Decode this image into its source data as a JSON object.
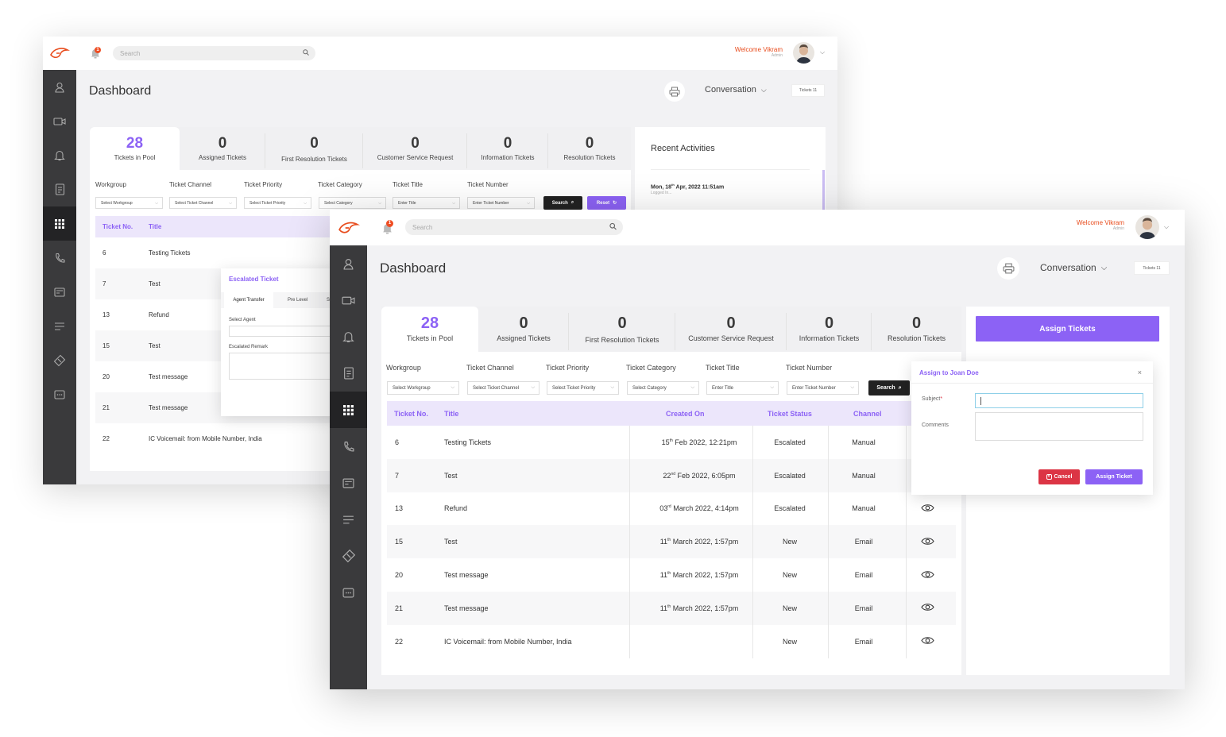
{
  "app": {
    "search_placeholder": "Search",
    "notifications": "1",
    "welcome": "Welcome Vikram",
    "role": "Admin",
    "page_title": "Dashboard",
    "conversation": "Conversation",
    "tickets_badge": "Tickets 11"
  },
  "stats": [
    {
      "value": "28",
      "label": "Tickets in Pool"
    },
    {
      "value": "0",
      "label": "Assigned Tickets"
    },
    {
      "value": "0",
      "label": "First Resolution Tickets"
    },
    {
      "value": "0",
      "label": "Customer Service Request"
    },
    {
      "value": "0",
      "label": "Information Tickets"
    },
    {
      "value": "0",
      "label": "Resolution Tickets"
    }
  ],
  "filters": {
    "labels": [
      "Workgroup",
      "Ticket Channel",
      "Ticket Priority",
      "Ticket Category",
      "Ticket Title",
      "Ticket Number"
    ],
    "placeholders": [
      "Select Workgroup",
      "Select Ticket Channel",
      "Select Ticket Priority",
      "Select Category",
      "Enter Title",
      "Enter Ticket Number"
    ],
    "search": "Search",
    "reset": "Reset"
  },
  "table": {
    "headers": [
      "Ticket No.",
      "Title",
      "Created On",
      "Ticket Status",
      "Channel"
    ],
    "rows": [
      {
        "no": "6",
        "title": "Testing Tickets",
        "created_main": "15",
        "created_sup": "th",
        "created_rest": " Feb 2022, 12:21pm",
        "status": "Escalated",
        "channel": "Manual"
      },
      {
        "no": "7",
        "title": "Test",
        "created_main": "22",
        "created_sup": "nd",
        "created_rest": " Feb 2022, 6:05pm",
        "status": "Escalated",
        "channel": "Manual"
      },
      {
        "no": "13",
        "title": "Refund",
        "created_main": "03",
        "created_sup": "rd",
        "created_rest": " March 2022, 4:14pm",
        "status": "Escalated",
        "channel": "Manual"
      },
      {
        "no": "15",
        "title": "Test",
        "created_main": "11",
        "created_sup": "th",
        "created_rest": " March 2022, 1:57pm",
        "status": "New",
        "channel": "Email"
      },
      {
        "no": "20",
        "title": "Test message",
        "created_main": "11",
        "created_sup": "th",
        "created_rest": " March 2022, 1:57pm",
        "status": "New",
        "channel": "Email"
      },
      {
        "no": "21",
        "title": "Test message",
        "created_main": "11",
        "created_sup": "th",
        "created_rest": " March 2022, 1:57pm",
        "status": "New",
        "channel": "Email"
      },
      {
        "no": "22",
        "title": "IC Voicemail: from Mobile Number, India",
        "created_main": "",
        "created_sup": "",
        "created_rest": "",
        "status": "New",
        "channel": "Email"
      }
    ]
  },
  "recent": {
    "title": "Recent Activities",
    "date_main": "Mon, 18",
    "date_sup": "th",
    "date_rest": " Apr, 2022 11:51am",
    "text": "Logged In..."
  },
  "escalated": {
    "title": "Escalated Ticket",
    "tabs": [
      "Agent Transfer",
      "Pre Level",
      "S"
    ],
    "select_agent": "Select Agent",
    "remark": "Escalated Remark"
  },
  "assign": {
    "button": "Assign Tickets",
    "modal_title": "Assign to Joan Doe",
    "close": "×",
    "subject": "Subject",
    "required": "*",
    "comments": "Comments",
    "cancel": "Cancel",
    "submit": "Assign Ticket"
  },
  "colors": {
    "accent": "#8c62f5",
    "brand": "#e84c1d",
    "sidebar": "#3a3a3c",
    "danger": "#dc3545"
  }
}
